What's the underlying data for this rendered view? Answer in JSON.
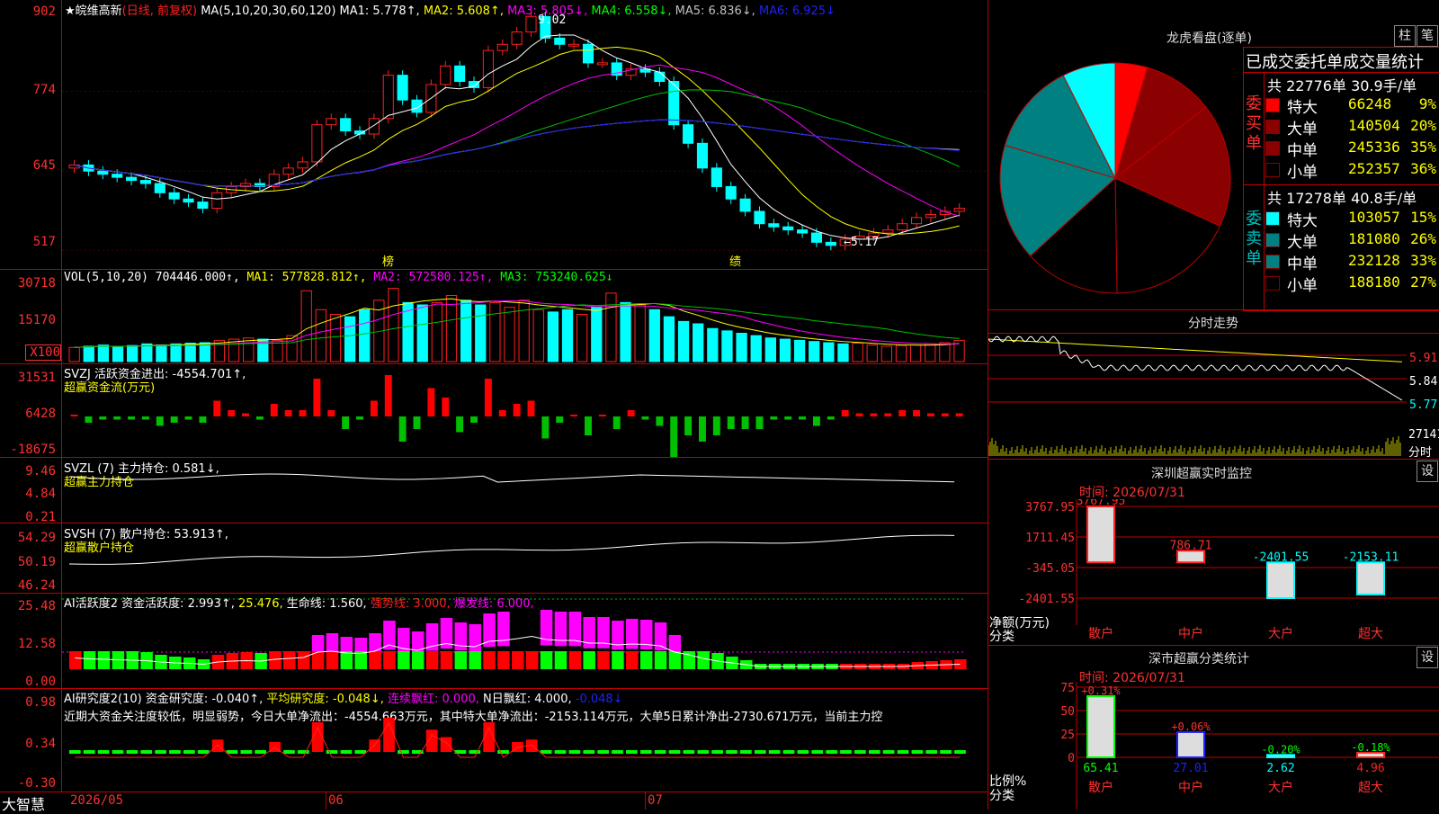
{
  "colors": {
    "up": "#ff2020",
    "down": "#00ffff",
    "ma_white": "#ffffff",
    "ma_yellow": "#ffff00",
    "ma_magenta": "#ff00ff",
    "ma_green": "#00c000",
    "ma_blue": "#2020ff",
    "ma_gray": "#c0c0c0",
    "grid": "#c00000"
  },
  "main_chart": {
    "title": "★皖维高新",
    "period": "(日线, 前复权)",
    "ma_label": "MA(5,10,20,30,60,120)",
    "ma1": "MA1: 5.778↑,",
    "ma2": "MA2: 5.608↑,",
    "ma3": "MA3: 5.805↓,",
    "ma4": "MA4: 6.558↓,",
    "ma5": "MA5: 6.836↓,",
    "ma6": "MA6: 6.925↓",
    "y_ticks": [
      "902",
      "774",
      "645",
      "517"
    ],
    "high_label": "9.02",
    "low_label": "←5.17",
    "marker_bang": "榜",
    "marker_ji": "绩"
  },
  "vol_panel": {
    "label": "VOL(5,10,20)",
    "value": "704446.000↑,",
    "ma1": "MA1: 577828.812↑,",
    "ma2": "MA2: 572580.125↑,",
    "ma3": "MA3: 753240.625↓",
    "y_ticks": [
      "30718",
      "15170",
      "X100"
    ]
  },
  "svzj_panel": {
    "label": "SVZJ  活跃资金进出: -4554.701↑,",
    "sub": "超赢资金流(万元)",
    "y_ticks": [
      "31531",
      "6428",
      "-18675"
    ]
  },
  "svzl_panel": {
    "label": "SVZL (7) 主力持仓: 0.581↓,",
    "sub": "超赢主力持仓",
    "y_ticks": [
      "9.46",
      "4.84",
      "0.21"
    ]
  },
  "svsh_panel": {
    "label": "SVSH (7) 散户持仓: 53.913↑,",
    "sub": "超赢散户持仓",
    "y_ticks": [
      "54.29",
      "50.19",
      "46.24"
    ]
  },
  "ai_active_panel": {
    "label": "AI活跃度2 资金活跃度: 2.993↑,",
    "v2": "25.476,",
    "v3": "生命线: 1.560,",
    "v4": "强势线: 3.000,",
    "v5": "爆发线: 6.000,",
    "y_ticks": [
      "25.48",
      "12.58",
      "0.00"
    ]
  },
  "ai_research_panel": {
    "label": "AI研究度2(10) 资金研究度: -0.040↑,",
    "v2": "平均研究度: -0.048↓,",
    "v3": "连续飘红: 0.000,",
    "v4": "N日飘红: 4.000,",
    "v5": "-0.048↓",
    "desc": "近期大资金关注度较低，明显弱势，今日大单净流出：-4554.663万元，其中特大单净流出：-2153.114万元，大单5日累计净出-2730.671万元，当前主力控",
    "y_ticks": [
      "0.98",
      "0.34",
      "-0.30"
    ]
  },
  "bottom_axis": {
    "app": "大智慧",
    "dates": [
      "2026/05",
      "06",
      "07"
    ]
  },
  "dragon_tiger": {
    "title": "龙虎看盘(逐单)",
    "btn_column": "柱",
    "btn_pen": "笔",
    "subtitle": "已成交委托单成交量统计",
    "buy_side": "委买单",
    "buy_total": "共 22776单 30.9手/单",
    "buy_rows": [
      {
        "label": "特大",
        "value": "66248",
        "pct": "9%",
        "color": "#ff0000"
      },
      {
        "label": "大单",
        "value": "140504",
        "pct": "20%",
        "color": "#8b0000"
      },
      {
        "label": "中单",
        "value": "245336",
        "pct": "35%",
        "color": "#8b0000"
      },
      {
        "label": "小单",
        "value": "252357",
        "pct": "36%",
        "color": "#000000"
      }
    ],
    "sell_side": "委卖单",
    "sell_total": "共 17278单 40.8手/单",
    "sell_rows": [
      {
        "label": "特大",
        "value": "103057",
        "pct": "15%",
        "color": "#00ffff"
      },
      {
        "label": "大单",
        "value": "181080",
        "pct": "26%",
        "color": "#008080"
      },
      {
        "label": "中单",
        "value": "232128",
        "pct": "33%",
        "color": "#008080"
      },
      {
        "label": "小单",
        "value": "188180",
        "pct": "27%",
        "color": "#000000"
      }
    ]
  },
  "pie_data": {
    "slices": [
      {
        "value": 9,
        "color": "#ff0000"
      },
      {
        "value": 20,
        "color": "#8b0000"
      },
      {
        "value": 35,
        "color": "#8b0000"
      },
      {
        "value": 36,
        "color": "#000000"
      },
      {
        "value": 27,
        "color": "#000000"
      },
      {
        "value": 33,
        "color": "#008080"
      },
      {
        "value": 26,
        "color": "#008080"
      },
      {
        "value": 15,
        "color": "#00ffff"
      }
    ]
  },
  "intraday": {
    "title": "分时走势",
    "y_ticks": [
      "5.91",
      "5.84",
      "5.77"
    ],
    "vol_tick": "27141",
    "vol_unit": "分时"
  },
  "sz_monitor": {
    "title": "深圳超赢实时监控",
    "btn": "设",
    "time": "时间: 2026/07/31",
    "y_ticks": [
      "3767.95",
      "1711.45",
      "-345.05",
      "-2401.55"
    ],
    "axis_label1": "净额(万元)",
    "axis_label2": "分类",
    "bars": [
      {
        "cat": "散户",
        "value": 3767.95,
        "label": "3767.95"
      },
      {
        "cat": "中户",
        "value": 786.71,
        "label": "786.71"
      },
      {
        "cat": "大户",
        "value": -2401.55,
        "label": "-2401.55"
      },
      {
        "cat": "超大",
        "value": -2153.11,
        "label": "-2153.11"
      }
    ]
  },
  "sz_category": {
    "title": "深市超赢分类统计",
    "btn": "设",
    "time": "时间: 2026/07/31",
    "y_ticks": [
      "75",
      "50",
      "25",
      "0"
    ],
    "axis_label1": "比例%",
    "axis_label2": "分类",
    "bars": [
      {
        "cat": "散户",
        "value": 65.41,
        "label": "65.41",
        "delta": "+0.31%",
        "color": "#00ff00"
      },
      {
        "cat": "中户",
        "value": 27.01,
        "label": "27.01",
        "delta": "+0.06%",
        "color": "#2020ff"
      },
      {
        "cat": "大户",
        "value": 2.62,
        "label": "2.62",
        "delta": "-0.20%",
        "color": "#00ffff"
      },
      {
        "cat": "超大",
        "value": 4.96,
        "label": "4.96",
        "delta": "-0.18%",
        "color": "#ff2020"
      }
    ]
  },
  "chart_data": {
    "type": "candlestick",
    "symbol": "皖维高新",
    "ylim": [
      5.17,
      9.02
    ],
    "ohlc_close": [
      6.55,
      6.45,
      6.4,
      6.35,
      6.3,
      6.25,
      6.1,
      6.0,
      5.95,
      5.85,
      6.1,
      6.2,
      6.25,
      6.2,
      6.4,
      6.5,
      6.6,
      7.2,
      7.3,
      7.1,
      7.05,
      7.3,
      8.0,
      7.6,
      7.4,
      7.85,
      8.15,
      7.9,
      7.8,
      8.4,
      8.5,
      8.7,
      8.95,
      8.6,
      8.5,
      8.5,
      8.2,
      8.2,
      8.0,
      8.1,
      8.05,
      7.9,
      7.2,
      6.9,
      6.5,
      6.2,
      6.0,
      5.8,
      5.6,
      5.55,
      5.5,
      5.45,
      5.3,
      5.25,
      5.35,
      5.4,
      5.45,
      5.5,
      5.6,
      5.7,
      5.75,
      5.8,
      5.85
    ],
    "volume": [
      6000,
      6500,
      7000,
      6200,
      6800,
      7500,
      7000,
      7500,
      7800,
      8000,
      9000,
      9500,
      10000,
      9500,
      9000,
      11000,
      30000,
      22000,
      20000,
      19000,
      22000,
      26000,
      31000,
      25000,
      24000,
      25000,
      28000,
      26000,
      24000,
      25000,
      23000,
      26000,
      22000,
      21000,
      22000,
      20000,
      23000,
      29000,
      25000,
      24000,
      22000,
      19000,
      17000,
      16000,
      14000,
      13000,
      12000,
      11000,
      10000,
      9500,
      9000,
      8500,
      8000,
      7500,
      7800,
      7000,
      6500,
      6800,
      7000,
      7500,
      8000,
      9000
    ]
  }
}
